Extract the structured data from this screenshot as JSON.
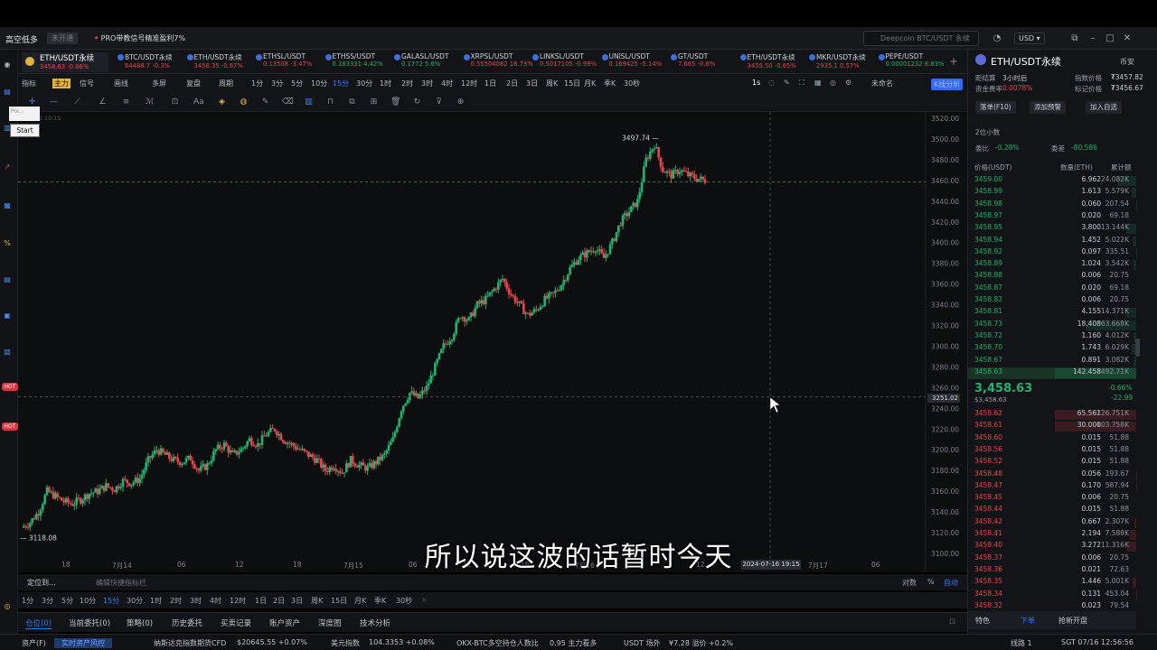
{
  "titlebar": {
    "brand": "高空低多",
    "status_pill": "未开通",
    "promo": "PRO带教信号精准盈利7%",
    "search_placeholder": "Deepcoin BTC/USDT 永续",
    "currency": "USD"
  },
  "tickers": [
    {
      "name": "ETH/USDT永续",
      "price": "3458.63",
      "change": "-0.66%",
      "dir": "down",
      "active": true
    },
    {
      "name": "BTC/USDT永续",
      "price": "64488.7",
      "change": "-0.3%",
      "dir": "down"
    },
    {
      "name": "ETH/USDT永续",
      "price": "3458.35",
      "change": "-0.67%",
      "dir": "down"
    },
    {
      "name": "ETHSL/USDT",
      "price": "0.13508",
      "change": "-3.47%",
      "dir": "down"
    },
    {
      "name": "ETHSS/USDT",
      "price": "0.183331",
      "change": "4.42%",
      "dir": "up"
    },
    {
      "name": "GALASL/USDT",
      "price": "0.1772",
      "change": "5.6%",
      "dir": "up"
    },
    {
      "name": "XRPSL/USDT",
      "price": "0.55504082",
      "change": "16.73%",
      "dir": "down"
    },
    {
      "name": "LINKSL/USDT",
      "price": "0.5017105",
      "change": "-0.99%",
      "dir": "down"
    },
    {
      "name": "UNISL/USDT",
      "price": "0.169425",
      "change": "-5.14%",
      "dir": "down"
    },
    {
      "name": "GT/USDT",
      "price": "7.665",
      "change": "-0.6%",
      "dir": "down"
    },
    {
      "name": "ETH/USDT永续",
      "price": "3459.50",
      "change": "-0.65%",
      "dir": "down"
    },
    {
      "name": "MKR/USDT永续",
      "price": "2935.1",
      "change": "0.57%",
      "dir": "down"
    },
    {
      "name": "PEPE/USDT",
      "price": "0.00001232",
      "change": "8.83%",
      "dir": "up"
    }
  ],
  "toolbar1": {
    "items": [
      "指标",
      "主力",
      "信号",
      "画线",
      "多屏",
      "复盘",
      "周期",
      "1分",
      "3分",
      "5分",
      "10分",
      "15分",
      "30分",
      "1时",
      "2时",
      "3时",
      "4时",
      "12时",
      "1日",
      "2日",
      "3日",
      "周K",
      "15日",
      "月K",
      "季K",
      "30秒"
    ],
    "selected": "15分",
    "interval_right": "1s",
    "unnamed": "未命名",
    "kline_analysis": "K线分析"
  },
  "chart": {
    "timestamp_watermark": "07-16 19:15",
    "widget_placeholder": "Poi...",
    "widget_button": "Start",
    "y_ticks": [
      "3520.00",
      "3500.00",
      "3480.00",
      "3460.00",
      "3440.00",
      "3420.00",
      "3400.00",
      "3380.00",
      "3360.00",
      "3340.00",
      "3320.00",
      "3300.00",
      "3280.00",
      "3260.00",
      "3240.00",
      "3220.00",
      "3200.00",
      "3180.00",
      "3160.00",
      "3140.00",
      "3120.00",
      "3100.00"
    ],
    "x_ticks": [
      "18",
      "7月14",
      "06",
      "12",
      "18",
      "7月15",
      "06",
      "12",
      "18",
      "7月16",
      "12",
      "7月17",
      "06"
    ],
    "high_label": "3497.74",
    "low_label": "3118.08",
    "crosshair_price": "3251.02",
    "crosshair_time": "2024-07-16 19:15",
    "caption": "所以说这波的话暂时今天"
  },
  "chart_data": {
    "type": "candlestick",
    "ylim": [
      3100,
      3520
    ],
    "close_path": [
      3125,
      3130,
      3140,
      3160,
      3155,
      3150,
      3148,
      3152,
      3158,
      3160,
      3165,
      3162,
      3170,
      3168,
      3172,
      3190,
      3200,
      3195,
      3190,
      3188,
      3192,
      3180,
      3185,
      3200,
      3205,
      3195,
      3200,
      3210,
      3205,
      3215,
      3220,
      3210,
      3205,
      3200,
      3195,
      3190,
      3180,
      3185,
      3178,
      3190,
      3185,
      3182,
      3188,
      3195,
      3210,
      3240,
      3255,
      3250,
      3260,
      3280,
      3300,
      3310,
      3330,
      3325,
      3340,
      3345,
      3355,
      3365,
      3350,
      3340,
      3330,
      3335,
      3345,
      3350,
      3360,
      3375,
      3385,
      3390,
      3395,
      3385,
      3400,
      3420,
      3430,
      3440,
      3480,
      3495,
      3470,
      3465,
      3470,
      3465,
      3462,
      3460
    ],
    "high": 3497.74,
    "low": 3118.08
  },
  "bottom_controls": {
    "locate": "定位到...",
    "edit_shortcut": "编辑快捷指标栏",
    "compare": "对数",
    "percent": "%",
    "auto": "自动",
    "intervals": [
      "1分",
      "3分",
      "5分",
      "10分",
      "15分",
      "30分",
      "1时",
      "2时",
      "3时",
      "4时",
      "12时",
      "1日",
      "2日",
      "3日",
      "周K",
      "15日",
      "月K",
      "季K",
      "30秒"
    ],
    "selected": "15分"
  },
  "tabs": [
    "仓位(0)",
    "当前委托(0)",
    "策略(0)",
    "历史委托",
    "买卖记录",
    "账户资产",
    "深度图",
    "技术分析"
  ],
  "statusbar": {
    "asset": "资产(F)",
    "risk": "实时资产风控",
    "index1_name": "纳斯达克指数期货CFD",
    "index1_val": "$20645.55 +0.07%",
    "index2_name": "美元指数",
    "index2_val": "104.3353 +0.08%",
    "okx": "OKX-BTC多空持仓人数比",
    "okx_val": "0.95 主力看多",
    "usdt": "USDT 场外",
    "usdt_val": "¥7.28 溢价 +0.2%",
    "line": "线路 1",
    "time": "SGT 07/16 12:56:56"
  },
  "panel": {
    "symbol": "ETH/USDT永续",
    "exchange": "币安",
    "funding_label": "距结算",
    "funding_val": "3小时后",
    "fee_label": "资金费率",
    "fee_val": "0.0078%",
    "index_label": "指数价格",
    "index_val": "₮3457.82",
    "mark_label": "标记价格",
    "mark_val": "₮3456.67",
    "btn_order": "落单(F10)",
    "btn_alert": "添加预警",
    "btn_fav": "加入自选",
    "precision": "2位小数",
    "ratio_label": "委比",
    "ratio_val": "-0.28%",
    "diff_label": "委差",
    "diff_val": "-80.586",
    "col_price": "价格(USDT)",
    "col_qty": "数量(ETH)",
    "col_total": "累计额",
    "asks": [
      [
        "3459.00",
        "6.962",
        "24.082K"
      ],
      [
        "3458.99",
        "1.613",
        "5.579K"
      ],
      [
        "3458.98",
        "0.060",
        "207.54"
      ],
      [
        "3458.97",
        "0.020",
        "69.18"
      ],
      [
        "3458.95",
        "3.800",
        "13.144K"
      ],
      [
        "3458.94",
        "1.452",
        "5.022K"
      ],
      [
        "3458.92",
        "0.097",
        "335.51"
      ],
      [
        "3458.89",
        "1.024",
        "3.542K"
      ],
      [
        "3458.88",
        "0.006",
        "20.75"
      ],
      [
        "3458.87",
        "0.020",
        "69.18"
      ],
      [
        "3458.82",
        "0.006",
        "20.75"
      ],
      [
        "3458.81",
        "4.155",
        "14.371K"
      ],
      [
        "3458.73",
        "18.408",
        "63.668K"
      ],
      [
        "3458.72",
        "1.160",
        "4.012K"
      ],
      [
        "3458.70",
        "1.743",
        "6.029K"
      ],
      [
        "3458.67",
        "0.891",
        "3.082K"
      ],
      [
        "3458.63",
        "142.458",
        "492.71K"
      ]
    ],
    "last_price": "3,458.63",
    "last_sub": "$3,458.63",
    "last_change_pct": "-0.66%",
    "last_change": "-22.99",
    "bids": [
      [
        "3458.62",
        "65.561",
        "226.751K"
      ],
      [
        "3458.61",
        "30.000",
        "103.758K"
      ],
      [
        "3458.60",
        "0.015",
        "51.88"
      ],
      [
        "3458.56",
        "0.015",
        "51.88"
      ],
      [
        "3458.52",
        "0.015",
        "51.88"
      ],
      [
        "3458.48",
        "0.056",
        "193.67"
      ],
      [
        "3458.47",
        "0.170",
        "587.94"
      ],
      [
        "3458.45",
        "0.006",
        "20.75"
      ],
      [
        "3458.44",
        "0.015",
        "51.88"
      ],
      [
        "3458.42",
        "0.667",
        "2.307K"
      ],
      [
        "3458.41",
        "2.194",
        "7.588K"
      ],
      [
        "3458.40",
        "3.272",
        "11.316K"
      ],
      [
        "3458.37",
        "0.006",
        "20.75"
      ],
      [
        "3458.36",
        "0.021",
        "72.63"
      ],
      [
        "3458.35",
        "1.446",
        "5.001K"
      ],
      [
        "3458.34",
        "0.131",
        "453.04"
      ],
      [
        "3458.32",
        "0.023",
        "79.54"
      ]
    ],
    "tabs": [
      "特色",
      "下单",
      "抢新开盘"
    ]
  },
  "colors": {
    "up": "#21b26f",
    "down": "#e8434e",
    "accent": "#2f7bff",
    "bg": "#0d0e10"
  }
}
